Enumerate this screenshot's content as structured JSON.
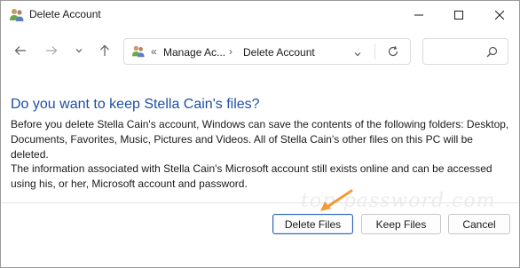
{
  "window": {
    "title": "Delete Account",
    "icon": "users-icon",
    "controls": [
      "minimize-icon",
      "maximize-icon",
      "close-icon"
    ]
  },
  "navigation": {
    "back_icon": "arrow-left-icon",
    "forward_icon": "arrow-right-icon",
    "recent_icon": "chevron-down-icon",
    "up_icon": "arrow-up-icon",
    "address": {
      "icon": "users-icon",
      "overflow": "«",
      "crumbs": [
        "Manage Ac...",
        "Delete Account"
      ],
      "separator": "›"
    },
    "search": {
      "placeholder": "",
      "icon": "search-icon"
    }
  },
  "content": {
    "heading": "Do you want to keep Stella Cain's files?",
    "paragraph1": "Before you delete Stella Cain's account, Windows can save the contents of the following folders: Desktop, Documents, Favorites, Music, Pictures and Videos. All of Stella Cain's other files on this PC will be deleted.",
    "paragraph2": "The information associated with Stella Cain's Microsoft account still exists online and can be accessed using his, or her, Microsoft account and password.",
    "watermark": "top-password.com"
  },
  "buttons": {
    "delete_files": "Delete Files",
    "keep_files": "Keep Files",
    "cancel": "Cancel"
  },
  "colors": {
    "heading": "#1e4fa5",
    "default_button_border": "#2b63b8",
    "annotation_arrow": "#f29a38"
  }
}
